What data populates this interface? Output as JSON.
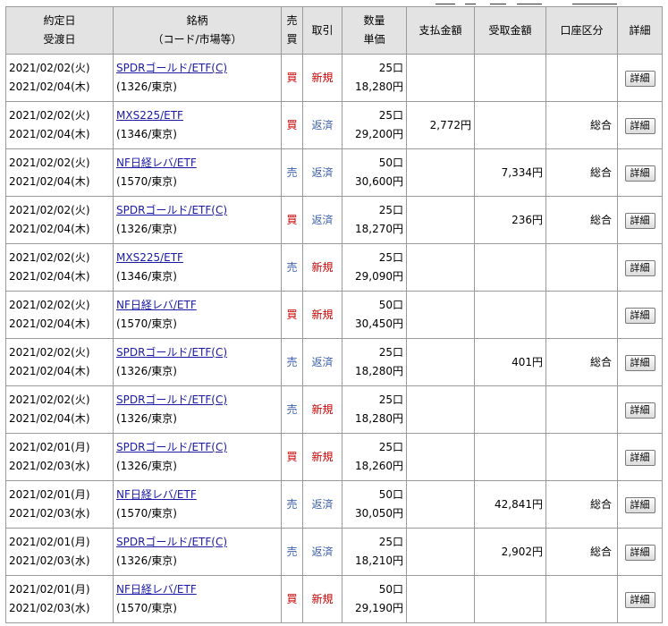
{
  "headers": {
    "date_line1": "約定日",
    "date_line2": "受渡日",
    "stock_line1": "銘柄",
    "stock_line2": "（コード/市場等）",
    "side_line1": "売",
    "side_line2": "買",
    "type": "取引",
    "qty_line1": "数量",
    "qty_line2": "単価",
    "pay": "支払金額",
    "receive": "受取金額",
    "account": "口座区分",
    "detail": "詳細"
  },
  "detail_button_label": "詳細",
  "rows": [
    {
      "trade_date": "2021/02/02(火)",
      "settle_date": "2021/02/04(木)",
      "name": "SPDRゴールド/ETF(C)",
      "code": "(1326/東京)",
      "side": "買",
      "type": "新規",
      "qty": "25口",
      "price": "18,280円",
      "pay": "",
      "receive": "",
      "account": ""
    },
    {
      "trade_date": "2021/02/02(火)",
      "settle_date": "2021/02/04(木)",
      "name": "MXS225/ETF",
      "code": "(1346/東京)",
      "side": "買",
      "type": "返済",
      "qty": "25口",
      "price": "29,200円",
      "pay": "2,772円",
      "receive": "",
      "account": "総合"
    },
    {
      "trade_date": "2021/02/02(火)",
      "settle_date": "2021/02/04(木)",
      "name": "NF日経レバ/ETF",
      "code": "(1570/東京)",
      "side": "売",
      "type": "返済",
      "qty": "50口",
      "price": "30,600円",
      "pay": "",
      "receive": "7,334円",
      "account": "総合"
    },
    {
      "trade_date": "2021/02/02(火)",
      "settle_date": "2021/02/04(木)",
      "name": "SPDRゴールド/ETF(C)",
      "code": "(1326/東京)",
      "side": "買",
      "type": "返済",
      "qty": "25口",
      "price": "18,270円",
      "pay": "",
      "receive": "236円",
      "account": "総合"
    },
    {
      "trade_date": "2021/02/02(火)",
      "settle_date": "2021/02/04(木)",
      "name": "MXS225/ETF",
      "code": "(1346/東京)",
      "side": "売",
      "type": "新規",
      "qty": "25口",
      "price": "29,090円",
      "pay": "",
      "receive": "",
      "account": ""
    },
    {
      "trade_date": "2021/02/02(火)",
      "settle_date": "2021/02/04(木)",
      "name": "NF日経レバ/ETF",
      "code": "(1570/東京)",
      "side": "買",
      "type": "新規",
      "qty": "50口",
      "price": "30,450円",
      "pay": "",
      "receive": "",
      "account": ""
    },
    {
      "trade_date": "2021/02/02(火)",
      "settle_date": "2021/02/04(木)",
      "name": "SPDRゴールド/ETF(C)",
      "code": "(1326/東京)",
      "side": "売",
      "type": "返済",
      "qty": "25口",
      "price": "18,280円",
      "pay": "",
      "receive": "401円",
      "account": "総合"
    },
    {
      "trade_date": "2021/02/02(火)",
      "settle_date": "2021/02/04(木)",
      "name": "SPDRゴールド/ETF(C)",
      "code": "(1326/東京)",
      "side": "売",
      "type": "新規",
      "qty": "25口",
      "price": "18,280円",
      "pay": "",
      "receive": "",
      "account": ""
    },
    {
      "trade_date": "2021/02/01(月)",
      "settle_date": "2021/02/03(水)",
      "name": "SPDRゴールド/ETF(C)",
      "code": "(1326/東京)",
      "side": "買",
      "type": "新規",
      "qty": "25口",
      "price": "18,260円",
      "pay": "",
      "receive": "",
      "account": ""
    },
    {
      "trade_date": "2021/02/01(月)",
      "settle_date": "2021/02/03(水)",
      "name": "NF日経レバ/ETF",
      "code": "(1570/東京)",
      "side": "売",
      "type": "返済",
      "qty": "50口",
      "price": "30,050円",
      "pay": "",
      "receive": "42,841円",
      "account": "総合"
    },
    {
      "trade_date": "2021/02/01(月)",
      "settle_date": "2021/02/03(水)",
      "name": "SPDRゴールド/ETF(C)",
      "code": "(1326/東京)",
      "side": "売",
      "type": "返済",
      "qty": "25口",
      "price": "18,210円",
      "pay": "",
      "receive": "2,902円",
      "account": "総合"
    },
    {
      "trade_date": "2021/02/01(月)",
      "settle_date": "2021/02/03(水)",
      "name": "NF日経レバ/ETF",
      "code": "(1570/東京)",
      "side": "買",
      "type": "新規",
      "qty": "50口",
      "price": "29,190円",
      "pay": "",
      "receive": "",
      "account": ""
    }
  ],
  "colors": {
    "header_bg": "#e3e3e3",
    "border": "#9a9a9a",
    "link": "#1a1aa6",
    "buy_red": "#cc0000",
    "sell_blue": "#3b5fb0"
  }
}
